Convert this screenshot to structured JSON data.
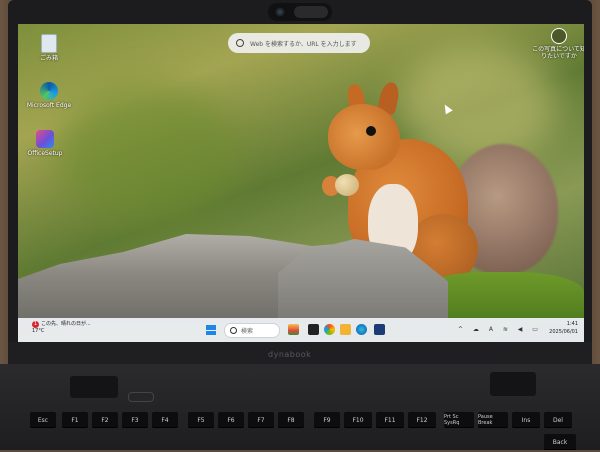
{
  "desktop": {
    "icons": [
      {
        "label": "ごみ箱",
        "icon": "recycle-bin-icon"
      },
      {
        "label": "Microsoft Edge",
        "icon": "edge-icon"
      },
      {
        "label": "OfficeSetup",
        "icon": "office-icon"
      }
    ],
    "search_placeholder": "Web を検索するか、URL を入力します",
    "picture_info": "この写真について知りたいですか",
    "colors": {
      "taskbar": "#ebeef3",
      "accent": "#1f86e6"
    }
  },
  "taskbar": {
    "weather_line1": "この先、晴れの日が...",
    "weather_line2": "17°C",
    "weather_badge": "1",
    "search_label": "検索",
    "clock_time": "1:41",
    "clock_date": "2025/06/01"
  },
  "laptop": {
    "brand": "dynabook"
  },
  "keyboard": {
    "row1": [
      "Esc",
      "F1",
      "F2",
      "F3",
      "F4",
      "F5",
      "F6",
      "F7",
      "F8",
      "F9",
      "F10",
      "F11",
      "F12",
      "Prt Sc SysRq",
      "Pause Break",
      "Ins",
      "Del"
    ],
    "row2_right": "Back"
  }
}
